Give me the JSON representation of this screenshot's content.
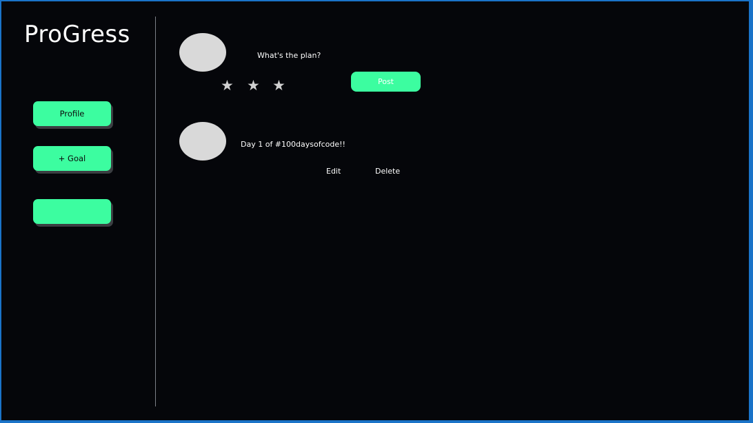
{
  "app": {
    "title": "ProGress"
  },
  "sidebar": {
    "items": [
      {
        "label": "Profile"
      },
      {
        "label": "+ Goal"
      },
      {
        "label": ""
      }
    ]
  },
  "composer": {
    "prompt": "What's the plan?",
    "stars": [
      "★",
      "★",
      "★"
    ],
    "post_label": "Post"
  },
  "feed": {
    "posts": [
      {
        "text": "Day 1 of #100daysofcode!!",
        "edit_label": "Edit",
        "delete_label": "Delete"
      }
    ]
  },
  "colors": {
    "accent": "#3cfda0",
    "background": "#05060a",
    "border": "#1a73c8",
    "avatar": "#d9d9d9"
  }
}
